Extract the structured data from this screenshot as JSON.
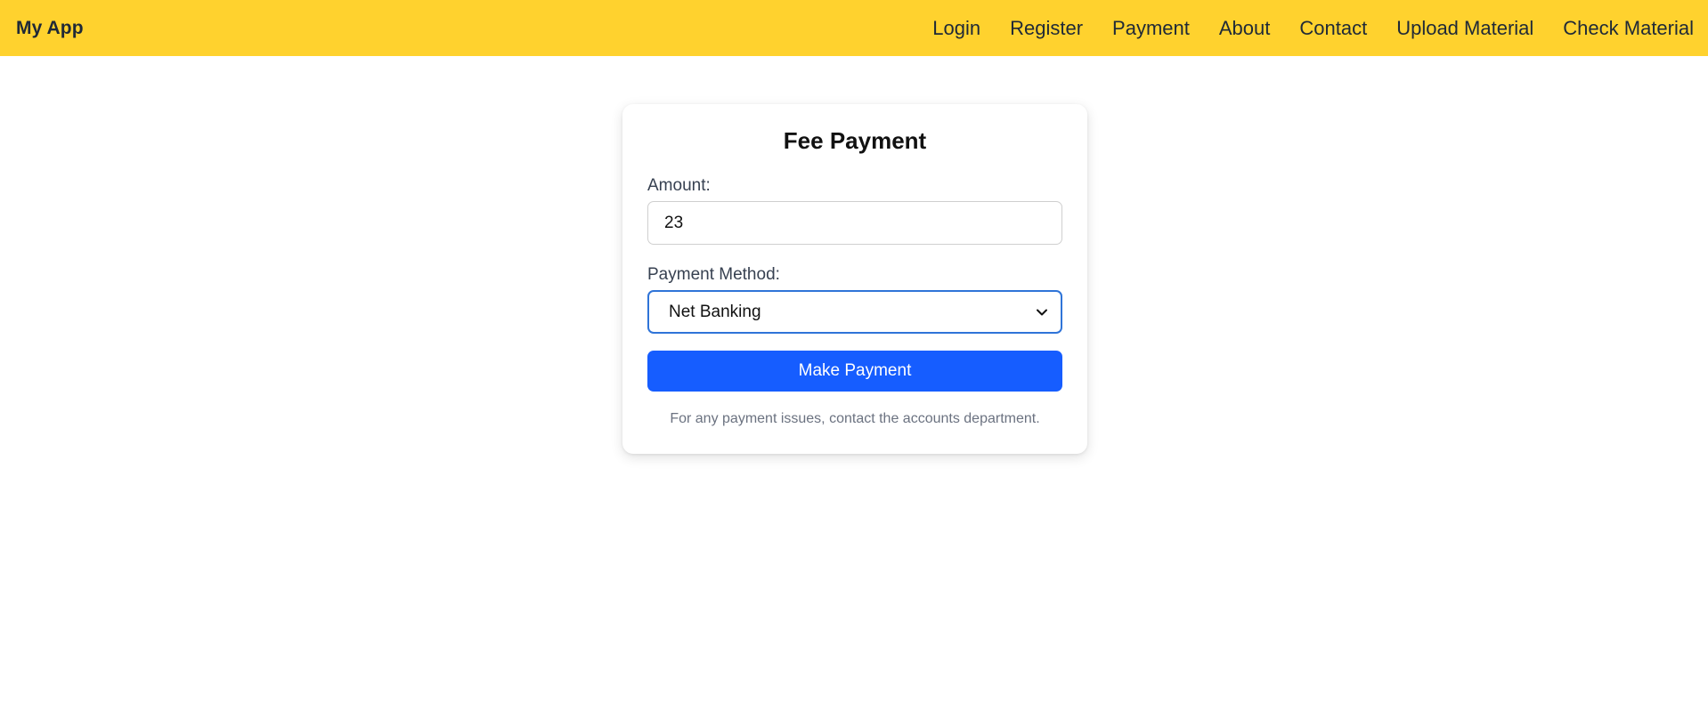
{
  "navbar": {
    "brand": "My App",
    "links": [
      {
        "label": "Login"
      },
      {
        "label": "Register"
      },
      {
        "label": "Payment"
      },
      {
        "label": "About"
      },
      {
        "label": "Contact"
      },
      {
        "label": "Upload Material"
      },
      {
        "label": "Check Material"
      }
    ],
    "color": "#ffd22e"
  },
  "form": {
    "title": "Fee Payment",
    "amount_label": "Amount:",
    "amount_value": "23",
    "method_label": "Payment Method:",
    "method_value": "Net Banking",
    "submit_label": "Make Payment",
    "help_text": "For any payment issues, contact the accounts department.",
    "button_color": "#165dff",
    "focus_color": "#2f74d8"
  },
  "icons": {
    "select_arrow": "chevron-down-icon"
  }
}
